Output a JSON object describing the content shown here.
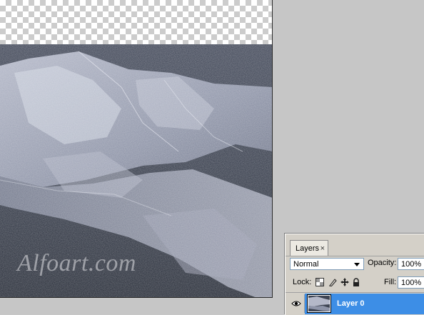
{
  "watermark": "Alfoart.com",
  "layers_panel": {
    "tab_label": "Layers",
    "tab_close": "×",
    "blend_mode": "Normal",
    "opacity_label": "Opacity:",
    "opacity_value": "100%",
    "lock_label": "Lock:",
    "fill_label": "Fill:",
    "fill_value": "100%",
    "layers": [
      {
        "name": "Layer 0",
        "visible": true,
        "selected": true
      }
    ]
  },
  "colors": {
    "selection": "#3d8ee6",
    "panel_bg": "#d4d0c8",
    "workspace_bg": "#c6c6c6"
  }
}
